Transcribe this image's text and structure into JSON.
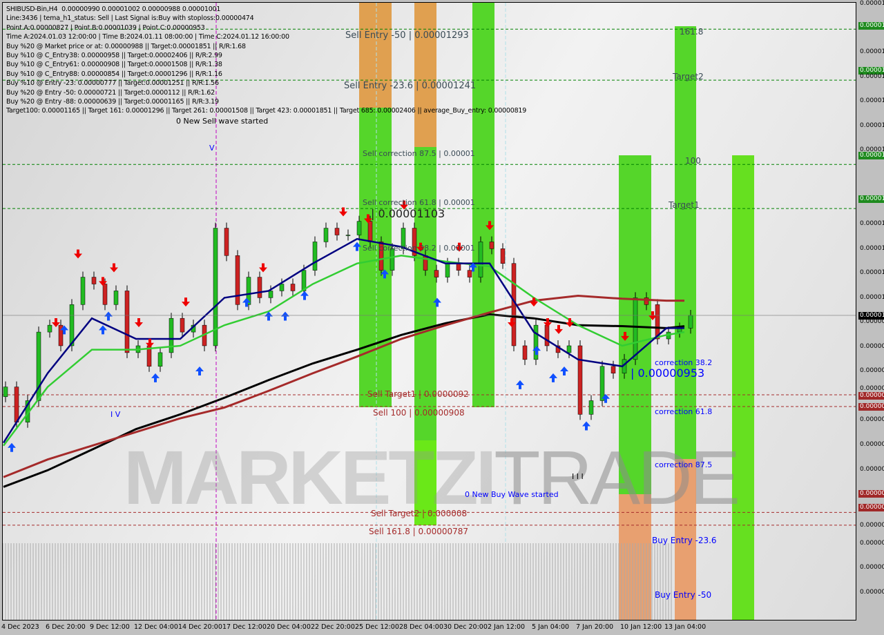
{
  "header": {
    "lines": [
      "SHIBUSD-Bin,H4  0.00000990 0.00001002 0.00000988 0.00001001",
      "Line:3436 | tema_h1_status: Sell | Last Signal is:Buy with stoploss:0.00000474",
      "Point A:0.00000827 | Point B:0.00001039 | Point C:0.00000953",
      "Time A:2024.01.03 12:00:00 | Time B:2024.01.11 08:00:00 | Time C:2024.01.12 16:00:00",
      "Buy %20 @ Market price or at: 0.00000988 || Target:0.00001851 || R/R:1.68",
      "Buy %10 @ C_Entry38: 0.00000958 || Target:0.00002406 || R/R:2.99",
      "Buy %10 @ C_Entry61: 0.00000908 || Target:0.00001508 || R/R:1.38",
      "Buy %10 @ C_Entry88: 0.00000854 || Target:0.00001296 || R/R:1.16",
      "Buy %10 @ Entry -23: 0.00000777 || Target:0.00001251 || R/R:1.56",
      "Buy %20 @ Entry -50: 0.00000721 || Target:0.0000112 || R/R:1.62",
      "Buy %20 @ Entry -88: 0.00000639 || Target:0.00001165 || R/R:3.19",
      "Target100: 0.00001165 || Target 161: 0.00001296 || Target 261: 0.00001508 || Target 423: 0.00001851 || Target 685: 0.00002406 || average_Buy_entry: 0.00000819"
    ]
  },
  "watermark": {
    "a": "MARKETZI",
    "b": "TRADE"
  },
  "labels": {
    "sell_entry_50": "Sell Entry -50 | 0.00001293",
    "sell_entry_236": "Sell Entry -23.6 | 0.00001241",
    "sell_corr_875": "Sell correction 87.5 | 0.00001",
    "sell_corr_618": "Sell correction 61.8 | 0.00001",
    "sell_corr_382": "Sell correction 38.2 | 0.00001",
    "price_b": "| 0.00001103",
    "new_sell": "0 New Sell wave started",
    "new_buy": "0 New Buy Wave started",
    "sell_t1": "Sell Target1 | 0.0000092",
    "sell_100": "Sell 100 | 0.00000908",
    "sell_t2": "Sell Target2 | 0.000008",
    "sell_1618": "Sell 161.8 | 0.00000787",
    "t1618": "161.8",
    "target2": "Target2",
    "l100": "100",
    "target1": "Target1",
    "corr382": "correction 38.2",
    "price_c": "| 0.00000953",
    "corr618": "correction 61.8",
    "corr875": "correction 87.5",
    "buy_236": "Buy Entry -23.6",
    "buy_50": "Buy Entry -50",
    "wave_iv": "I V",
    "wave_v": "V",
    "wave_iii": "I I I"
  },
  "price_axis": [
    {
      "t": "0.00001",
      "hl": ""
    },
    {
      "t": "0.00001",
      "hl": "green"
    },
    {
      "t": "0.00001",
      "hl": ""
    },
    {
      "t": "0.00001",
      "hl": "green"
    },
    {
      "t": "0.00001",
      "hl": ""
    },
    {
      "t": "0.00001",
      "hl": ""
    },
    {
      "t": "0.00001",
      "hl": ""
    },
    {
      "t": "0.00001",
      "hl": ""
    },
    {
      "t": "0.00001",
      "hl": "green"
    },
    {
      "t": "0.00001",
      "hl": "green"
    },
    {
      "t": "0.00001",
      "hl": ""
    },
    {
      "t": "0.00001",
      "hl": ""
    },
    {
      "t": "0.00001",
      "hl": ""
    },
    {
      "t": "0.00001",
      "hl": ""
    },
    {
      "t": "0.00000",
      "hl": ""
    },
    {
      "t": "0.00000",
      "hl": ""
    },
    {
      "t": "0.00000",
      "hl": ""
    },
    {
      "t": "0.00000",
      "hl": ""
    },
    {
      "t": "0.00000",
      "hl": "red"
    },
    {
      "t": "0.00000",
      "hl": "red"
    },
    {
      "t": "0.00000",
      "hl": ""
    },
    {
      "t": "0.00000",
      "hl": ""
    },
    {
      "t": "0.00000",
      "hl": ""
    },
    {
      "t": "0.00000",
      "hl": "red"
    },
    {
      "t": "0.00000",
      "hl": "red"
    },
    {
      "t": "0.00000",
      "hl": ""
    },
    {
      "t": "0.00000",
      "hl": ""
    },
    {
      "t": "0.00000",
      "hl": ""
    },
    {
      "t": "0.00000",
      "hl": ""
    },
    {
      "t": "0.00001",
      "hl": "black"
    }
  ],
  "chart_data": {
    "type": "candlestick",
    "symbol": "SHIBUSD-Bin",
    "timeframe": "H4",
    "x_tick_labels": [
      "4 Dec 2023",
      "6 Dec 20:00",
      "9 Dec 12:00",
      "12 Dec 04:00",
      "14 Dec 20:00",
      "17 Dec 12:00",
      "20 Dec 04:00",
      "22 Dec 20:00",
      "25 Dec 12:00",
      "28 Dec 04:00",
      "30 Dec 20:00",
      "2 Jan 12:00",
      "5 Jan 04:00",
      "7 Jan 20:00",
      "10 Jan 12:00",
      "13 Jan 04:00"
    ],
    "current_price": 1.001e-05,
    "close": [
      928,
      892,
      914,
      984,
      991,
      970,
      1012,
      1040,
      1033,
      1012,
      1026,
      963,
      970,
      949,
      963,
      998,
      984,
      991,
      970,
      1090,
      1062,
      1012,
      1040,
      1019,
      1026,
      1033,
      1026,
      1047,
      1076,
      1090,
      1083,
      1083,
      1097,
      1076,
      1047,
      1069,
      1090,
      1062,
      1047,
      1040,
      1054,
      1047,
      1040,
      1076,
      1069,
      1054,
      970,
      956,
      991,
      970,
      963,
      970,
      900,
      914,
      949,
      942,
      956,
      1019,
      1012,
      977,
      984,
      988,
      1001
    ],
    "close_unit": "1e-8",
    "moving_averages": [
      {
        "color": "#000000",
        "values": [
          826,
          843,
          864,
          885,
          900,
          917,
          935,
          952,
          966,
          981,
          993,
          1002,
          998,
          991,
          990,
          988,
          990
        ]
      },
      {
        "color": "#a52a2a",
        "values": [
          836,
          854,
          868,
          882,
          896,
          907,
          924,
          942,
          959,
          977,
          991,
          1004,
          1016,
          1021,
          1018,
          1016,
          1016
        ]
      },
      {
        "color": "#32cd32",
        "values": [
          868,
          928,
          966,
          966,
          970,
          991,
          1005,
          1033,
          1054,
          1062,
          1056,
          1051,
          1019,
          991,
          970,
          981,
          984
        ]
      },
      {
        "color": "#000080",
        "values": [
          871,
          942,
          998,
          977,
          977,
          1019,
          1026,
          1054,
          1079,
          1071,
          1054,
          1054,
          984,
          956,
          949,
          988,
          988
        ]
      }
    ],
    "levels": [
      {
        "price": 1.293e-05,
        "color": "#008000"
      },
      {
        "price": 1.241e-05,
        "color": "#008000"
      },
      {
        "price": 1.155e-05,
        "color": "#008000"
      },
      {
        "price": 1.11e-05,
        "color": "#008000"
      },
      {
        "price": 9.2e-06,
        "color": "#a52a2a"
      },
      {
        "price": 9.08e-06,
        "color": "#a52a2a"
      },
      {
        "price": 8e-06,
        "color": "#a52a2a"
      },
      {
        "price": 7.87e-06,
        "color": "#a52a2a"
      }
    ],
    "sell_signals": [
      19,
      27,
      36,
      40,
      49,
      53,
      66,
      94,
      123,
      132,
      145,
      151,
      165,
      176,
      184,
      192,
      197,
      201,
      205,
      225,
      235
    ],
    "buy_signals": [
      3,
      22,
      36,
      38,
      55,
      71,
      88,
      96,
      102,
      109,
      128,
      138,
      157,
      170,
      187,
      193,
      199,
      203,
      211,
      218
    ]
  }
}
